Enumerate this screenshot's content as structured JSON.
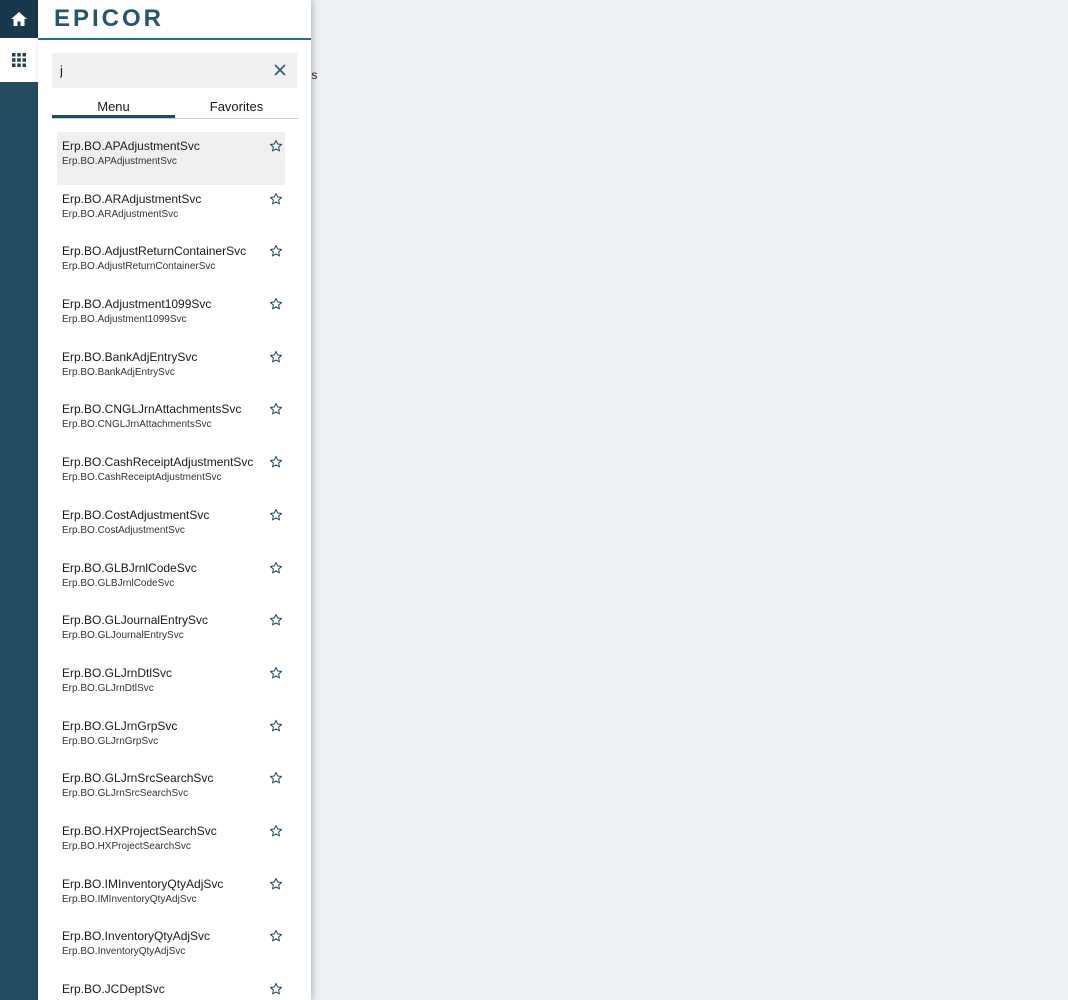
{
  "background": {
    "partial_text": "ons"
  },
  "logo": {
    "text": "EPICOR"
  },
  "search": {
    "value": "j"
  },
  "tabs": [
    {
      "label": "Menu"
    },
    {
      "label": "Favorites"
    }
  ],
  "items": [
    {
      "title": "Erp.BO.APAdjustmentSvc",
      "subtitle": "Erp.BO.APAdjustmentSvc"
    },
    {
      "title": "Erp.BO.ARAdjustmentSvc",
      "subtitle": "Erp.BO.ARAdjustmentSvc"
    },
    {
      "title": "Erp.BO.AdjustReturnContainerSvc",
      "subtitle": "Erp.BO.AdjustReturnContainerSvc"
    },
    {
      "title": "Erp.BO.Adjustment1099Svc",
      "subtitle": "Erp.BO.Adjustment1099Svc"
    },
    {
      "title": "Erp.BO.BankAdjEntrySvc",
      "subtitle": "Erp.BO.BankAdjEntrySvc"
    },
    {
      "title": "Erp.BO.CNGLJrnAttachmentsSvc",
      "subtitle": "Erp.BO.CNGLJrnAttachmentsSvc"
    },
    {
      "title": "Erp.BO.CashReceiptAdjustmentSvc",
      "subtitle": "Erp.BO.CashReceiptAdjustmentSvc"
    },
    {
      "title": "Erp.BO.CostAdjustmentSvc",
      "subtitle": "Erp.BO.CostAdjustmentSvc"
    },
    {
      "title": "Erp.BO.GLBJrnlCodeSvc",
      "subtitle": "Erp.BO.GLBJrnlCodeSvc"
    },
    {
      "title": "Erp.BO.GLJournalEntrySvc",
      "subtitle": "Erp.BO.GLJournalEntrySvc"
    },
    {
      "title": "Erp.BO.GLJrnDtlSvc",
      "subtitle": "Erp.BO.GLJrnDtlSvc"
    },
    {
      "title": "Erp.BO.GLJrnGrpSvc",
      "subtitle": "Erp.BO.GLJrnGrpSvc"
    },
    {
      "title": "Erp.BO.GLJrnSrcSearchSvc",
      "subtitle": "Erp.BO.GLJrnSrcSearchSvc"
    },
    {
      "title": "Erp.BO.HXProjectSearchSvc",
      "subtitle": "Erp.BO.HXProjectSearchSvc"
    },
    {
      "title": "Erp.BO.IMInventoryQtyAdjSvc",
      "subtitle": "Erp.BO.IMInventoryQtyAdjSvc"
    },
    {
      "title": "Erp.BO.InventoryQtyAdjSvc",
      "subtitle": "Erp.BO.InventoryQtyAdjSvc"
    },
    {
      "title": "Erp.BO.JCDeptSvc",
      "subtitle": ""
    }
  ],
  "colors": {
    "rail": "#244d5f",
    "rail_dark": "#17394a",
    "accent": "#1f4b60",
    "logo": "#25566d"
  },
  "icons": {
    "home": "home-icon",
    "apps": "grid-icon",
    "clear": "close-icon",
    "favorite": "star-outline-icon"
  }
}
